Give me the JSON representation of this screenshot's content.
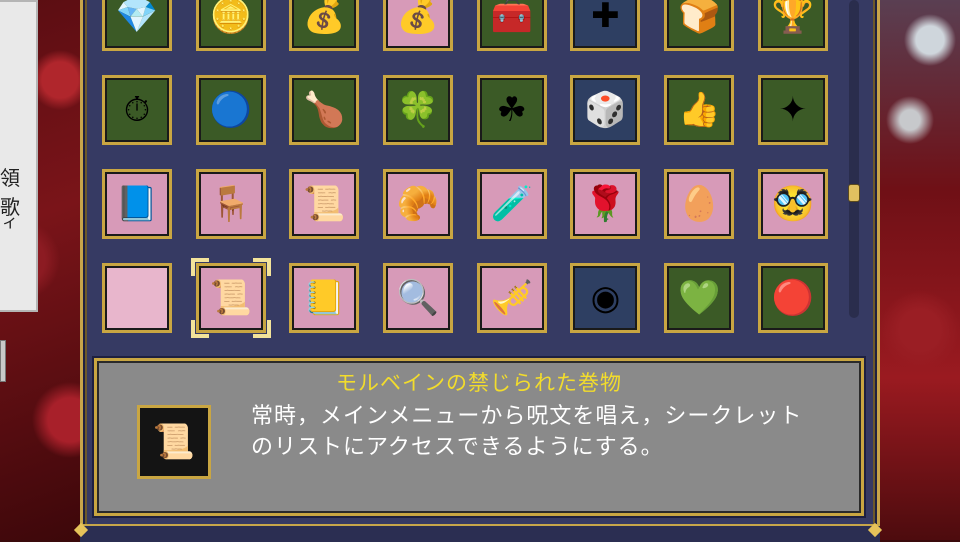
{
  "side_panel": {
    "text": "領歌",
    "text2": "ィ"
  },
  "grid": [
    [
      {
        "glyph": "💎",
        "bg": "green"
      },
      {
        "glyph": "🪙",
        "bg": "green"
      },
      {
        "glyph": "💰",
        "bg": "green"
      },
      {
        "glyph": "💰",
        "bg": "pink"
      },
      {
        "glyph": "🧰",
        "bg": "green"
      },
      {
        "glyph": "✚",
        "bg": "blue"
      },
      {
        "glyph": "🍞",
        "bg": "green"
      },
      {
        "glyph": "🏆",
        "bg": "green"
      }
    ],
    [
      {
        "glyph": "⏱",
        "bg": "green"
      },
      {
        "glyph": "🔵",
        "bg": "green"
      },
      {
        "glyph": "🍗",
        "bg": "green"
      },
      {
        "glyph": "🍀",
        "bg": "green"
      },
      {
        "glyph": "☘",
        "bg": "green"
      },
      {
        "glyph": "🎲",
        "bg": "blue"
      },
      {
        "glyph": "👍",
        "bg": "green"
      },
      {
        "glyph": "✦",
        "bg": "green"
      }
    ],
    [
      {
        "glyph": "📘",
        "bg": "pink"
      },
      {
        "glyph": "🪑",
        "bg": "pink"
      },
      {
        "glyph": "📜",
        "bg": "pink"
      },
      {
        "glyph": "🥐",
        "bg": "pink"
      },
      {
        "glyph": "🧪",
        "bg": "pink"
      },
      {
        "glyph": "🌹",
        "bg": "pink"
      },
      {
        "glyph": "🥚",
        "bg": "pink"
      },
      {
        "glyph": "🥸",
        "bg": "pink"
      }
    ],
    [
      {
        "glyph": "",
        "bg": "pink-light"
      },
      {
        "glyph": "📜",
        "bg": "pink",
        "selected": true
      },
      {
        "glyph": "📒",
        "bg": "pink"
      },
      {
        "glyph": "🔍",
        "bg": "pink"
      },
      {
        "glyph": "🎺",
        "bg": "pink"
      },
      {
        "glyph": "◉",
        "bg": "blue"
      },
      {
        "glyph": "💚",
        "bg": "green"
      },
      {
        "glyph": "🔴",
        "bg": "green"
      }
    ]
  ],
  "description": {
    "title": "モルベインの禁じられた巻物",
    "icon": "📜",
    "line1": "常時，メインメニューから呪文を唱え，シークレット",
    "line2": "のリストにアクセスできるようにする。"
  }
}
